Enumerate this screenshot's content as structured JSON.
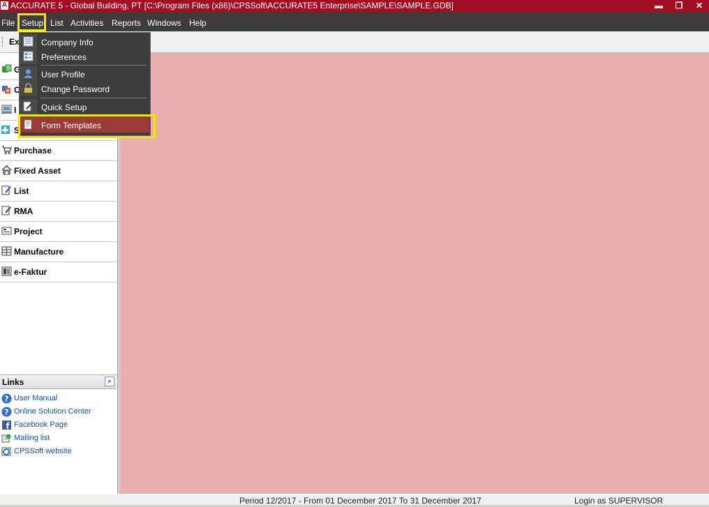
{
  "window": {
    "title": "ACCURATE 5  - Global Building, PT  [C:\\Program Files (x86)\\CPSSoft\\ACCURATE5 Enterprise\\SAMPLE\\SAMPLE.GDB]",
    "logo_letter": "A",
    "minimize_glyph": "▬",
    "restore_glyph": "❐",
    "close_glyph": "✕"
  },
  "menu": [
    {
      "id": "file",
      "label": "File"
    },
    {
      "id": "setup",
      "label": "Setup"
    },
    {
      "id": "list",
      "label": "List"
    },
    {
      "id": "activities",
      "label": "Activities"
    },
    {
      "id": "reports",
      "label": "Reports"
    },
    {
      "id": "windows",
      "label": "Windows"
    },
    {
      "id": "help",
      "label": "Help"
    }
  ],
  "toolbar": {
    "explorer_label": "Ex"
  },
  "setup_dropdown": {
    "items": [
      {
        "label": "Company Info",
        "icon": "document-list-icon"
      },
      {
        "label": "Preferences",
        "icon": "settings-list-icon"
      },
      {
        "label": "User Profile",
        "icon": "user-icon"
      },
      {
        "label": "Change Password",
        "icon": "lock-icon"
      },
      {
        "label": "Quick Setup",
        "icon": "quick-setup-icon"
      },
      {
        "label": "Form Templates",
        "icon": "form-template-icon",
        "highlighted": true
      }
    ],
    "highlight_color": "#9c3a3a"
  },
  "sidebar": {
    "items": [
      {
        "label": "G",
        "icon": "general-ledger-icon"
      },
      {
        "label": "C",
        "icon": "cash-bank-icon"
      },
      {
        "label": "I",
        "icon": "inventory-icon"
      },
      {
        "label": "S",
        "icon": "sales-icon"
      },
      {
        "label": "Purchase",
        "icon": "cart-icon"
      },
      {
        "label": "Fixed Asset",
        "icon": "house-icon"
      },
      {
        "label": "List",
        "icon": "list-icon"
      },
      {
        "label": "RMA",
        "icon": "rma-icon"
      },
      {
        "label": "Project",
        "icon": "project-icon"
      },
      {
        "label": "Manufacture",
        "icon": "manufacture-icon"
      },
      {
        "label": "e-Faktur",
        "icon": "efaktur-icon"
      }
    ]
  },
  "links": {
    "title": "Links",
    "collapse_glyph": "»",
    "items": [
      {
        "label": "User Manual",
        "icon": "help-icon"
      },
      {
        "label": "Online Solution Center",
        "icon": "help-icon"
      },
      {
        "label": "Facebook Page",
        "icon": "facebook-icon"
      },
      {
        "label": "Mailing list",
        "icon": "mail-icon"
      },
      {
        "label": "CPSSoft website",
        "icon": "web-icon"
      }
    ]
  },
  "status": {
    "period": "Period 12/2017 - From 01 December 2017 To 31 December 2017",
    "login": "Login as SUPERVISOR"
  },
  "colors": {
    "titlebar": "#a10d22",
    "menubar": "#3c3c3c",
    "workspace": "#e8aeae",
    "annotation_box": "#f5e600"
  }
}
